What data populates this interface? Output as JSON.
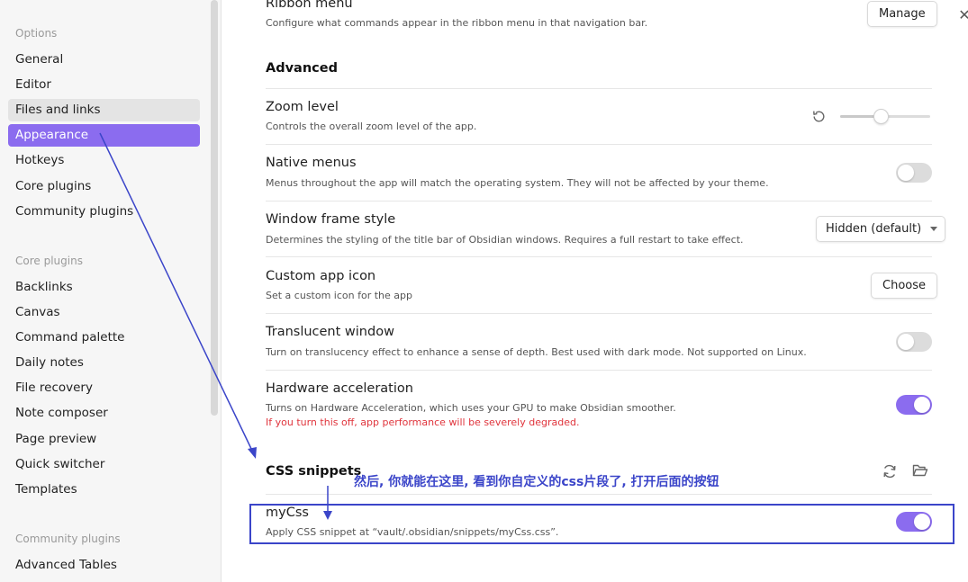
{
  "sidebar": {
    "options_heading": "Options",
    "options_items": [
      "General",
      "Editor",
      "Files and links",
      "Appearance",
      "Hotkeys",
      "Core plugins",
      "Community plugins"
    ],
    "core_heading": "Core plugins",
    "core_items": [
      "Backlinks",
      "Canvas",
      "Command palette",
      "Daily notes",
      "File recovery",
      "Note composer",
      "Page preview",
      "Quick switcher",
      "Templates"
    ],
    "community_heading": "Community plugins",
    "community_items": [
      "Advanced Tables"
    ],
    "active_item": "Appearance",
    "hover_item": "Files and links"
  },
  "close_icon": "close-icon",
  "ribbon": {
    "name": "Ribbon menu",
    "desc": "Configure what commands appear in the ribbon menu in that navigation bar.",
    "button": "Manage"
  },
  "advanced": {
    "heading": "Advanced",
    "zoom": {
      "name": "Zoom level",
      "desc": "Controls the overall zoom level of the app.",
      "reset_icon": "reset-icon",
      "value": 0.45
    },
    "native_menus": {
      "name": "Native menus",
      "desc": "Menus throughout the app will match the operating system. They will not be affected by your theme.",
      "enabled": false
    },
    "window_frame": {
      "name": "Window frame style",
      "desc": "Determines the styling of the title bar of Obsidian windows. Requires a full restart to take effect.",
      "selected": "Hidden (default)"
    },
    "custom_icon": {
      "name": "Custom app icon",
      "desc": "Set a custom icon for the app",
      "button": "Choose"
    },
    "translucent": {
      "name": "Translucent window",
      "desc": "Turn on translucency effect to enhance a sense of depth. Best used with dark mode. Not supported on Linux.",
      "enabled": false
    },
    "hardware": {
      "name": "Hardware acceleration",
      "desc": "Turns on Hardware Acceleration, which uses your GPU to make Obsidian smoother.",
      "warning": "If you turn this off, app performance will be severely degraded.",
      "enabled": true
    }
  },
  "snippets": {
    "heading": "CSS snippets",
    "reload_icon": "reload-icon",
    "folder_icon": "folder-icon",
    "items": [
      {
        "name": "myCss",
        "desc": "Apply CSS snippet at “vault/.obsidian/snippets/myCss.css”.",
        "enabled": true
      }
    ]
  },
  "annotation": {
    "text": "然后, 你就能在这里, 看到你自定义的css片段了, 打开后面的按钮",
    "color": "#3b45c9"
  },
  "colors": {
    "accent": "#8b6cef",
    "warning": "#e0343c",
    "annotation": "#3b45c9"
  }
}
